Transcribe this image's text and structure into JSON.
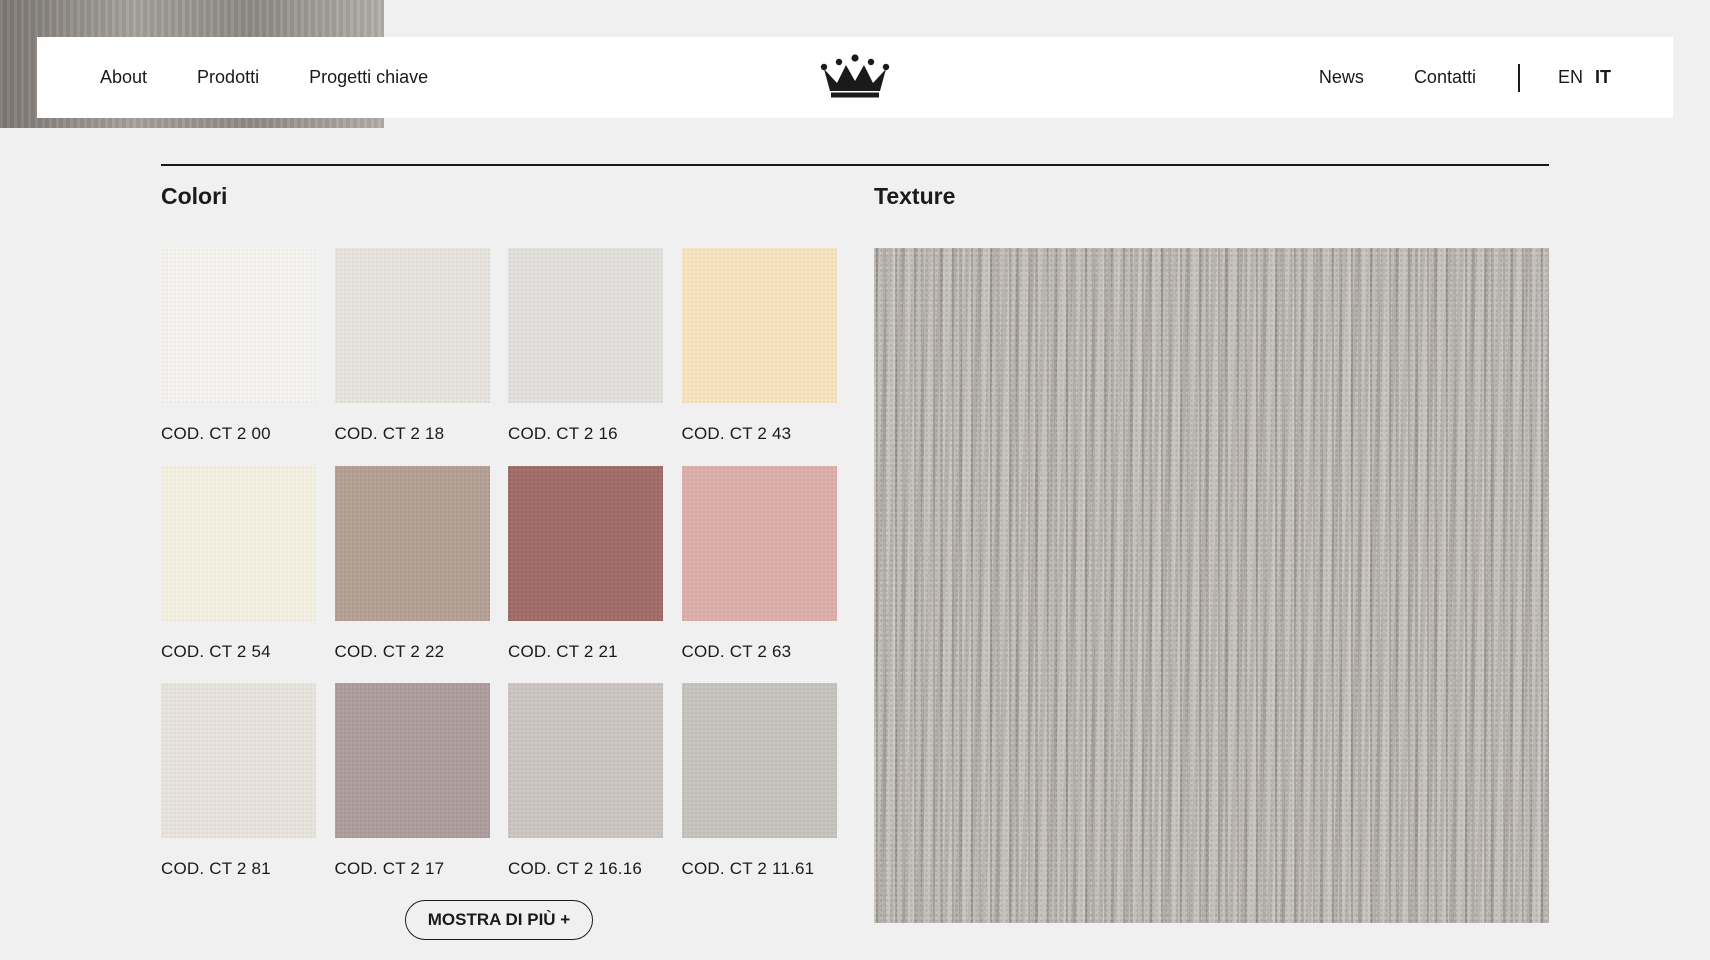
{
  "nav": {
    "left": [
      "About",
      "Prodotti",
      "Progetti chiave"
    ],
    "right": [
      "News",
      "Contatti"
    ],
    "languages": [
      "EN",
      "IT"
    ],
    "active_language": "IT",
    "logo_icon": "crown-icon"
  },
  "sections": {
    "colors_title": "Colori",
    "texture_title": "Texture"
  },
  "swatches": [
    {
      "code": "COD. CT 2 00",
      "color": "#f3f2ee"
    },
    {
      "code": "COD. CT 2 18",
      "color": "#e6e2dc"
    },
    {
      "code": "COD. CT 2 16",
      "color": "#e1dfdc"
    },
    {
      "code": "COD. CT 2 43",
      "color": "#f6e2be"
    },
    {
      "code": "COD. CT 2 54",
      "color": "#f4f0e1"
    },
    {
      "code": "COD. CT 2 22",
      "color": "#b39f93"
    },
    {
      "code": "COD. CT 2 21",
      "color": "#a06c68"
    },
    {
      "code": "COD. CT 2 63",
      "color": "#dcafac"
    },
    {
      "code": "COD. CT 2 81",
      "color": "#e7e3dc"
    },
    {
      "code": "COD. CT 2 17",
      "color": "#ad9c9b"
    },
    {
      "code": "COD. CT 2 16.16",
      "color": "#cbc4c1"
    },
    {
      "code": "COD. CT 2 11.61",
      "color": "#c6c2be"
    }
  ],
  "buttons": {
    "show_more": "MOSTRA DI PIÙ +"
  }
}
